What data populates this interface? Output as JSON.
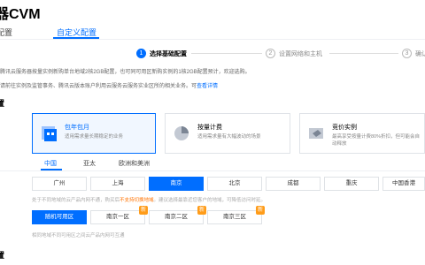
{
  "header": {
    "title": "器CVM",
    "tabs": [
      {
        "label": "配置"
      },
      {
        "label": "自定义配置",
        "active": true
      }
    ]
  },
  "steps": [
    {
      "number": "1",
      "label": "选择基础配置",
      "active": true
    },
    {
      "number": "2",
      "label": "设置网络和主机",
      "active": false
    },
    {
      "number": "3",
      "label": "确认",
      "active": false
    }
  ],
  "notices": {
    "line1": "腾讯云服务器按量实例新购单台地域2核2GB配置，也可同可用区新购实例的1核2GB配置预计，欢迎选购。",
    "line2_prefix": "请前往实例及监管事务、腾讯云版本账户利用云服务云服务实业区所的相关业务。可",
    "line2_link": "查看详情"
  },
  "sections": {
    "billing_label": "置",
    "bottom_label": "置"
  },
  "billing_cards": [
    {
      "title": "包年包月",
      "desc": "适用需求量长期稳定的业务",
      "selected": true,
      "icon": "calendar-icon"
    },
    {
      "title": "按量计费",
      "desc": "适用需求量有大幅波动的场景",
      "selected": false,
      "icon": "pie-chart-icon"
    },
    {
      "title": "竞价实例",
      "desc": "最高享受按量计费80%折扣，但可能会自动释放",
      "selected": false,
      "icon": "price-tag-icon"
    }
  ],
  "region_tabs": [
    {
      "label": "中国",
      "active": true
    },
    {
      "label": "亚太",
      "active": false
    },
    {
      "label": "欧洲和美洲",
      "active": false
    }
  ],
  "cities": [
    {
      "label": "广州",
      "selected": false
    },
    {
      "label": "上海",
      "selected": false
    },
    {
      "label": "南京",
      "selected": true
    },
    {
      "label": "北京",
      "selected": false
    },
    {
      "label": "成都",
      "selected": false
    },
    {
      "label": "重庆",
      "selected": false
    },
    {
      "label": "中国香港",
      "selected": false
    }
  ],
  "city_hint": {
    "prefix": "处于不同地域的云产品内网不通，购买后",
    "warn": "不支持切换地域",
    "suffix": "。建议选择最靠近您客户的地域，可降低访问时延。"
  },
  "zones": [
    {
      "label": "随机可用区",
      "selected": true,
      "badge": ""
    },
    {
      "label": "南京一区",
      "selected": false,
      "badge": "新"
    },
    {
      "label": "南京二区",
      "selected": false,
      "badge": "新"
    },
    {
      "label": "南京三区",
      "selected": false,
      "badge": "新"
    }
  ],
  "zone_hint": "相同地域不同可用区之间云产品内网可互通",
  "colors": {
    "accent": "#006eff",
    "warning": "#ff7200",
    "badge": "#ff9c19"
  }
}
